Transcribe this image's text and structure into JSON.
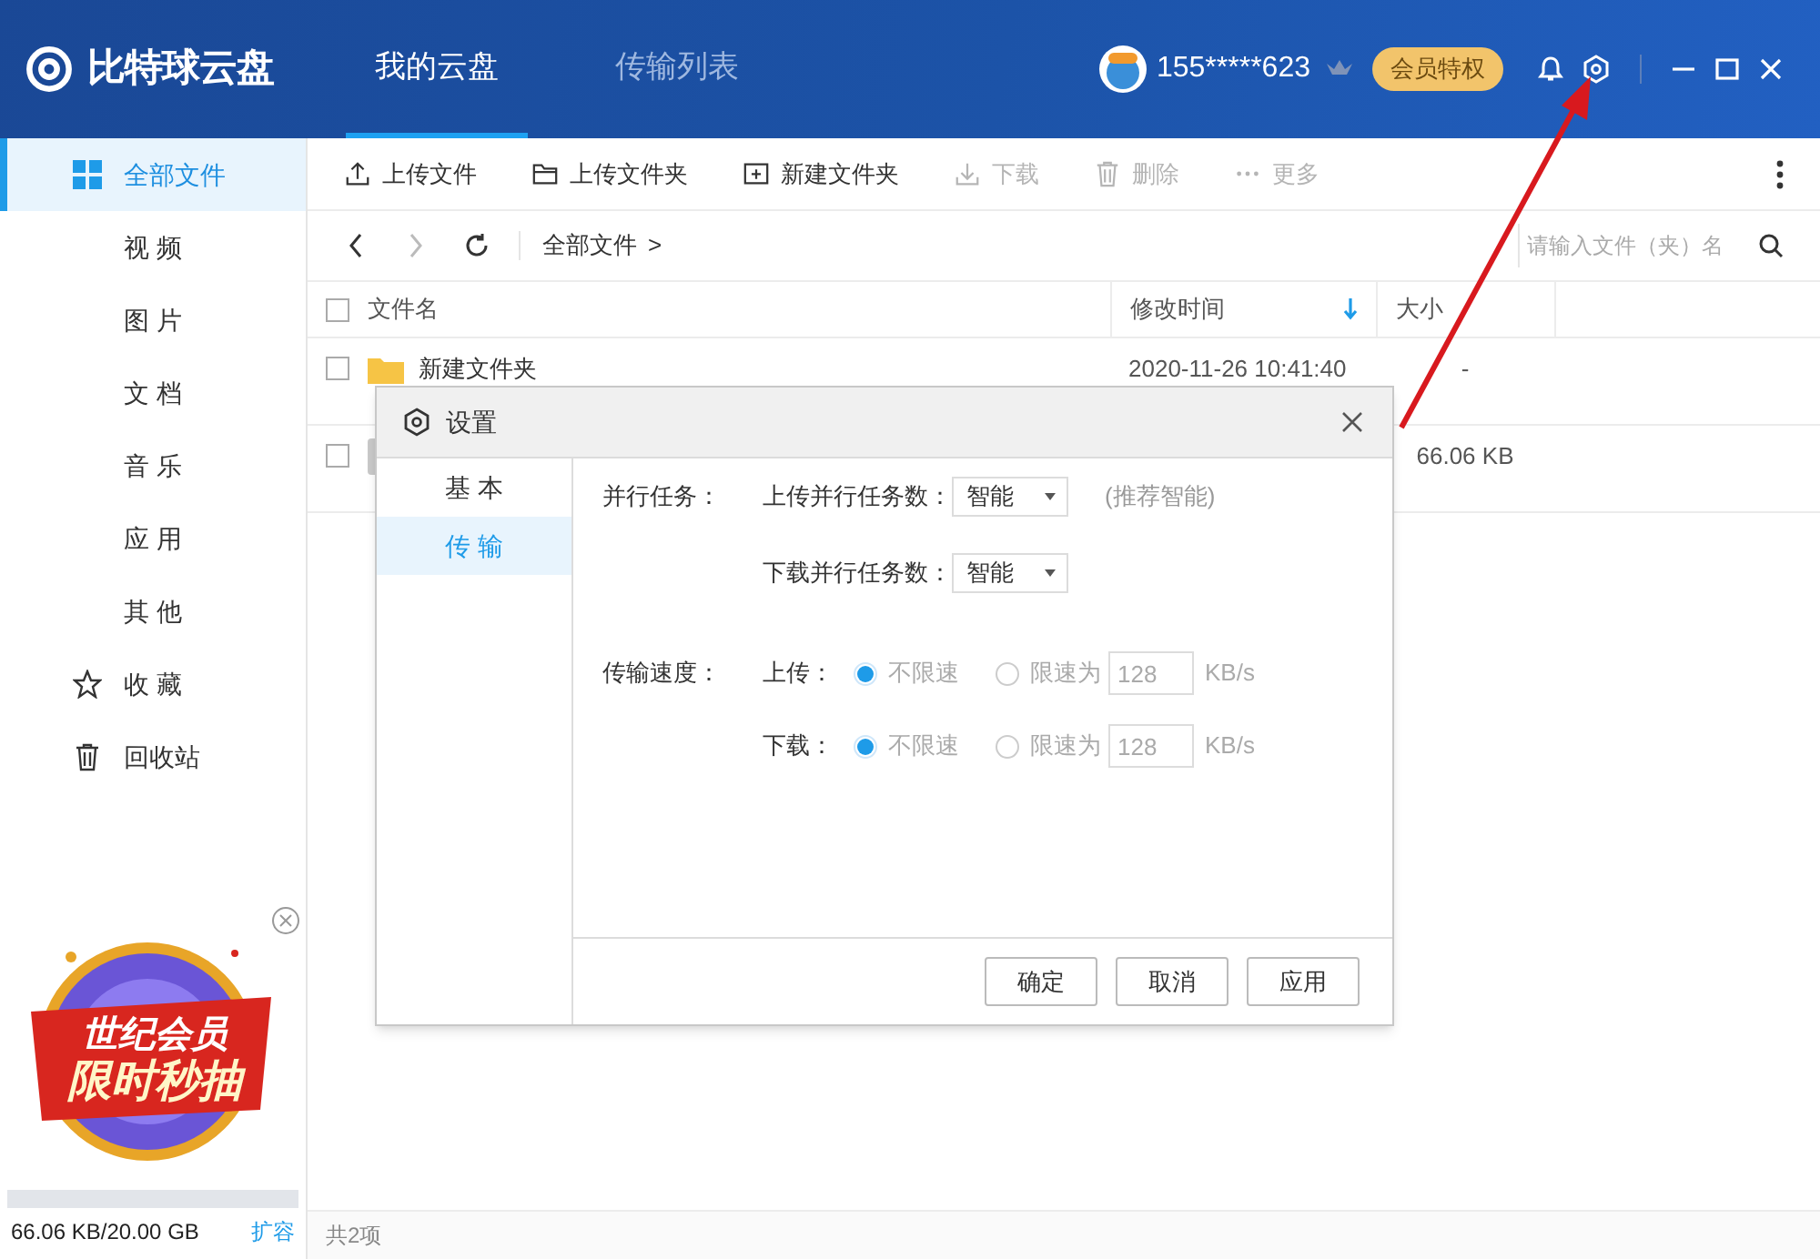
{
  "app": {
    "logo": "比特球云盘"
  },
  "header_tabs": [
    {
      "label": "我的云盘",
      "selected": true
    },
    {
      "label": "传输列表",
      "selected": false
    }
  ],
  "user": {
    "name": "155*****623",
    "vip_button": "会员特权"
  },
  "sidebar": {
    "items": [
      {
        "kind": "all",
        "label": "全部文件",
        "selected": true
      },
      {
        "kind": "category",
        "label": "视 频",
        "selected": false
      },
      {
        "kind": "category",
        "label": "图 片",
        "selected": false
      },
      {
        "kind": "category",
        "label": "文 档",
        "selected": false
      },
      {
        "kind": "category",
        "label": "音 乐",
        "selected": false
      },
      {
        "kind": "category",
        "label": "应 用",
        "selected": false
      },
      {
        "kind": "category",
        "label": "其 他",
        "selected": false
      },
      {
        "kind": "favorites",
        "label": "收 藏",
        "selected": false
      },
      {
        "kind": "trash",
        "label": "回收站",
        "selected": false
      }
    ],
    "promo": {
      "line1": "世纪会员",
      "line2": "限时秒抽"
    },
    "storage": {
      "level": 0,
      "text": "66.06 KB/20.00 GB",
      "expand_link": "扩容"
    }
  },
  "toolbar": [
    {
      "kind": "upload",
      "label": "上传文件",
      "disabled": false
    },
    {
      "kind": "upload_folder",
      "label": "上传文件夹",
      "disabled": false
    },
    {
      "kind": "new_folder",
      "label": "新建文件夹",
      "disabled": false
    },
    {
      "kind": "download",
      "label": "下载",
      "disabled": true
    },
    {
      "kind": "delete",
      "label": "删除",
      "disabled": true
    },
    {
      "kind": "more",
      "label": "更多",
      "disabled": true
    }
  ],
  "breadcrumb": {
    "path": "全部文件",
    "separator": ">"
  },
  "search": {
    "placeholder": "请输入文件（夹）名"
  },
  "table": {
    "select_all": {
      "checked": false
    },
    "columns": [
      {
        "label": "文件名",
        "sorted": false
      },
      {
        "label": "修改时间",
        "sorted": true
      },
      {
        "label": "大小",
        "sorted": false
      }
    ],
    "rows": [
      {
        "kind": "folder",
        "checked": false,
        "name": "新建文件夹",
        "modified": "2020-11-26 10:41:40",
        "size": "-"
      },
      {
        "kind": "file",
        "checked": false,
        "size": "66.06 KB"
      }
    ]
  },
  "status_bar": "共2项",
  "dialog": {
    "title": "设置",
    "nav": [
      {
        "label": "基 本",
        "selected": false
      },
      {
        "label": "传 输",
        "selected": true
      }
    ],
    "parallel": {
      "label": "并行任务：",
      "rows": [
        {
          "label": "上传并行任务数：",
          "value": "智能",
          "hint": "(推荐智能)"
        },
        {
          "label": "下载并行任务数：",
          "value": "智能"
        }
      ]
    },
    "speed": {
      "label": "传输速度：",
      "rows": [
        {
          "label": "上传：",
          "options": [
            {
              "label": "不限速",
              "selected": true
            },
            {
              "label": "限速为",
              "selected": false
            }
          ],
          "limit": "128",
          "unit": "KB/s"
        },
        {
          "label": "下载：",
          "options": [
            {
              "label": "不限速",
              "selected": true
            },
            {
              "label": "限速为",
              "selected": false
            }
          ],
          "limit": "128",
          "unit": "KB/s"
        }
      ]
    },
    "buttons": [
      "确定",
      "取消",
      "应用"
    ]
  }
}
